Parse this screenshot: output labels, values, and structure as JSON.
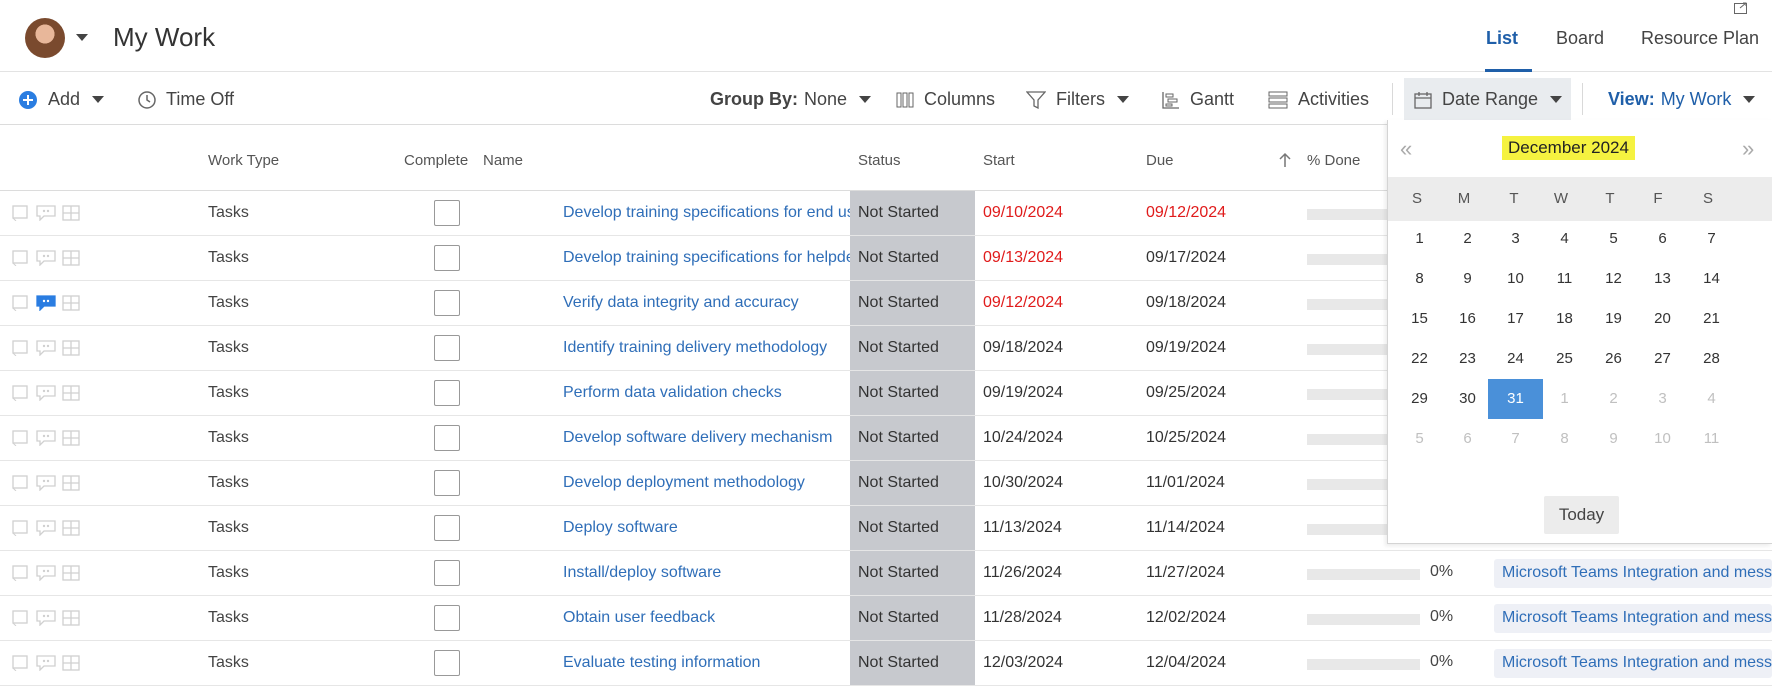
{
  "header": {
    "title": "My Work",
    "tabs": [
      {
        "label": "List",
        "active": true
      },
      {
        "label": "Board",
        "active": false
      },
      {
        "label": "Resource Plan",
        "active": false
      }
    ]
  },
  "toolbar": {
    "add": "Add",
    "time_off": "Time Off",
    "group_by_label": "Group By:",
    "group_by_value": "None",
    "columns": "Columns",
    "filters": "Filters",
    "gantt": "Gantt",
    "activities": "Activities",
    "date_range": "Date Range",
    "view_label": "View:",
    "view_value": "My Work"
  },
  "columns": {
    "work_type": "Work Type",
    "complete": "Complete",
    "name": "Name",
    "status": "Status",
    "start": "Start",
    "due": "Due",
    "done": "% Done"
  },
  "rows": [
    {
      "type": "Tasks",
      "name": "Develop training specifications for end users",
      "status": "Not Started",
      "start": "09/10/2024",
      "start_overdue": true,
      "due": "09/12/2024",
      "due_overdue": true,
      "pct": "",
      "project": "",
      "has_comment": false
    },
    {
      "type": "Tasks",
      "name": "Develop training specifications for helpdesk",
      "status": "Not Started",
      "start": "09/13/2024",
      "start_overdue": true,
      "due": "09/17/2024",
      "due_overdue": false,
      "pct": "",
      "project": "",
      "has_comment": false
    },
    {
      "type": "Tasks",
      "name": "Verify data integrity and accuracy",
      "status": "Not Started",
      "start": "09/12/2024",
      "start_overdue": true,
      "due": "09/18/2024",
      "due_overdue": false,
      "pct": "",
      "project": "",
      "has_comment": true
    },
    {
      "type": "Tasks",
      "name": "Identify training delivery methodology",
      "status": "Not Started",
      "start": "09/18/2024",
      "start_overdue": false,
      "due": "09/19/2024",
      "due_overdue": false,
      "pct": "",
      "project": "",
      "has_comment": false
    },
    {
      "type": "Tasks",
      "name": "Perform data validation checks",
      "status": "Not Started",
      "start": "09/19/2024",
      "start_overdue": false,
      "due": "09/25/2024",
      "due_overdue": false,
      "pct": "",
      "project": "",
      "has_comment": false
    },
    {
      "type": "Tasks",
      "name": "Develop software delivery mechanism",
      "status": "Not Started",
      "start": "10/24/2024",
      "start_overdue": false,
      "due": "10/25/2024",
      "due_overdue": false,
      "pct": "",
      "project": "",
      "has_comment": false
    },
    {
      "type": "Tasks",
      "name": "Develop deployment methodology",
      "status": "Not Started",
      "start": "10/30/2024",
      "start_overdue": false,
      "due": "11/01/2024",
      "due_overdue": false,
      "pct": "",
      "project": "",
      "has_comment": false
    },
    {
      "type": "Tasks",
      "name": "Deploy software",
      "status": "Not Started",
      "start": "11/13/2024",
      "start_overdue": false,
      "due": "11/14/2024",
      "due_overdue": false,
      "pct": "",
      "project": "",
      "has_comment": false
    },
    {
      "type": "Tasks",
      "name": "Install/deploy software",
      "status": "Not Started",
      "start": "11/26/2024",
      "start_overdue": false,
      "due": "11/27/2024",
      "due_overdue": false,
      "pct": "0%",
      "project": "Microsoft Teams Integration and messaging",
      "has_comment": false
    },
    {
      "type": "Tasks",
      "name": "Obtain user feedback",
      "status": "Not Started",
      "start": "11/28/2024",
      "start_overdue": false,
      "due": "12/02/2024",
      "due_overdue": false,
      "pct": "0%",
      "project": "Microsoft Teams Integration and messaging",
      "has_comment": false
    },
    {
      "type": "Tasks",
      "name": "Evaluate testing information",
      "status": "Not Started",
      "start": "12/03/2024",
      "start_overdue": false,
      "due": "12/04/2024",
      "due_overdue": false,
      "pct": "0%",
      "project": "Microsoft Teams Integration and messaging",
      "has_comment": false
    }
  ],
  "calendar": {
    "title": "December 2024",
    "prev": "«",
    "next": "»",
    "weekdays": [
      "S",
      "M",
      "T",
      "W",
      "T",
      "F",
      "S"
    ],
    "weeks": [
      [
        {
          "d": "1",
          "o": false
        },
        {
          "d": "2",
          "o": false
        },
        {
          "d": "3",
          "o": false
        },
        {
          "d": "4",
          "o": false
        },
        {
          "d": "5",
          "o": false
        },
        {
          "d": "6",
          "o": false
        },
        {
          "d": "7",
          "o": false
        }
      ],
      [
        {
          "d": "8",
          "o": false
        },
        {
          "d": "9",
          "o": false
        },
        {
          "d": "10",
          "o": false
        },
        {
          "d": "11",
          "o": false
        },
        {
          "d": "12",
          "o": false
        },
        {
          "d": "13",
          "o": false
        },
        {
          "d": "14",
          "o": false
        }
      ],
      [
        {
          "d": "15",
          "o": false
        },
        {
          "d": "16",
          "o": false
        },
        {
          "d": "17",
          "o": false
        },
        {
          "d": "18",
          "o": false
        },
        {
          "d": "19",
          "o": false
        },
        {
          "d": "20",
          "o": false
        },
        {
          "d": "21",
          "o": false
        }
      ],
      [
        {
          "d": "22",
          "o": false
        },
        {
          "d": "23",
          "o": false
        },
        {
          "d": "24",
          "o": false
        },
        {
          "d": "25",
          "o": false
        },
        {
          "d": "26",
          "o": false
        },
        {
          "d": "27",
          "o": false
        },
        {
          "d": "28",
          "o": false
        }
      ],
      [
        {
          "d": "29",
          "o": false
        },
        {
          "d": "30",
          "o": false
        },
        {
          "d": "31",
          "o": false,
          "sel": true
        },
        {
          "d": "1",
          "o": true
        },
        {
          "d": "2",
          "o": true
        },
        {
          "d": "3",
          "o": true
        },
        {
          "d": "4",
          "o": true
        }
      ],
      [
        {
          "d": "5",
          "o": true
        },
        {
          "d": "6",
          "o": true
        },
        {
          "d": "7",
          "o": true
        },
        {
          "d": "8",
          "o": true
        },
        {
          "d": "9",
          "o": true
        },
        {
          "d": "10",
          "o": true
        },
        {
          "d": "11",
          "o": true
        }
      ]
    ],
    "today": "Today",
    "highlight_color": "#f5f240",
    "selected_color": "#4a90d9"
  },
  "colors": {
    "accent": "#1f5fa9",
    "link": "#2f6eb8",
    "overdue": "#e01b1b",
    "status_band": "#c7c9ce"
  }
}
